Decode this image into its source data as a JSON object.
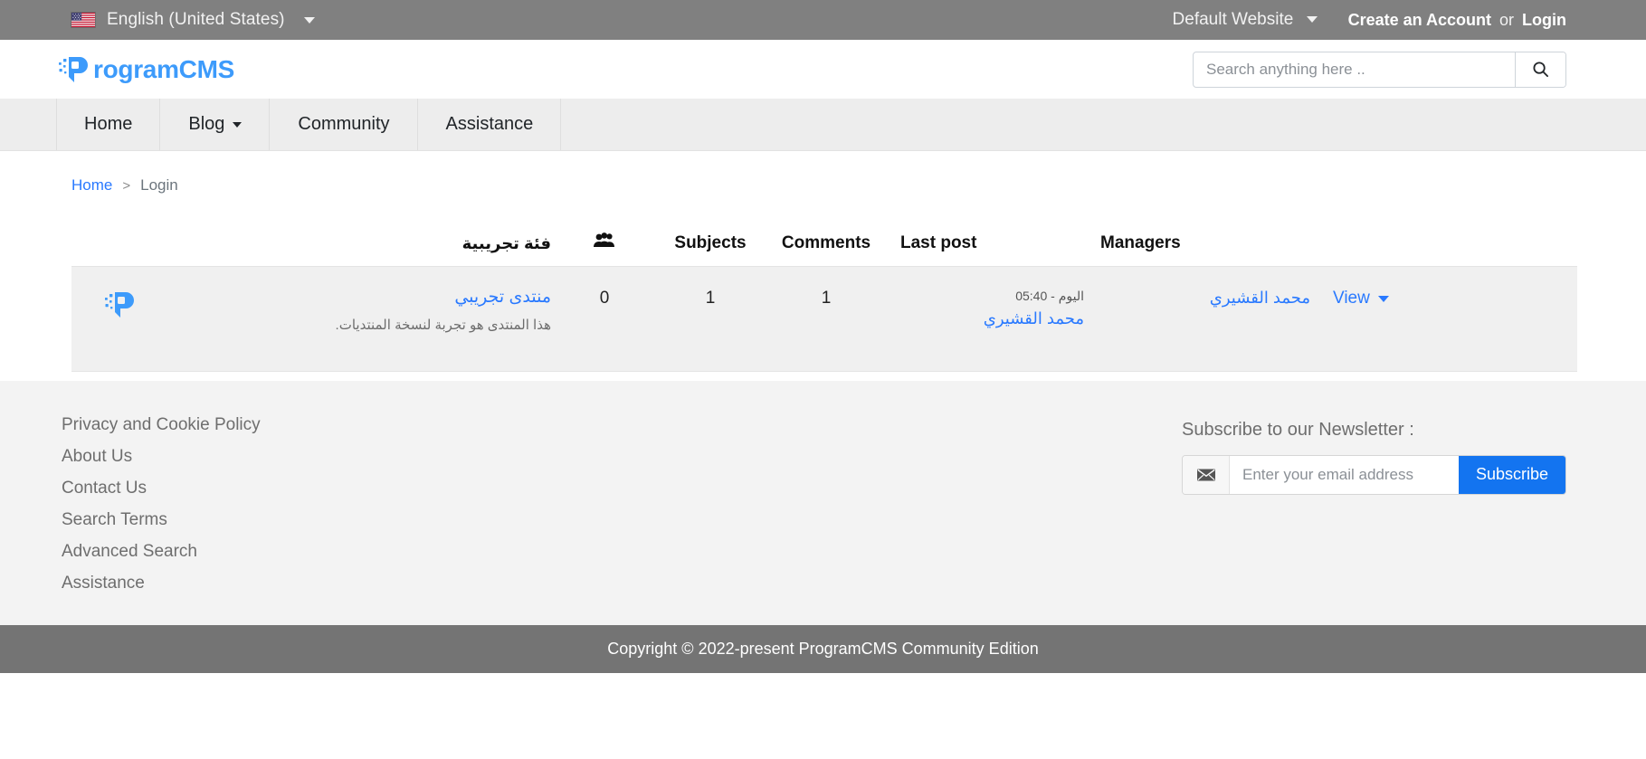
{
  "topbar": {
    "flag_icon": "us-flag-icon",
    "language": "English (United States)",
    "language_caret": "chevron-down-icon",
    "website_switcher": "Default Website",
    "create_account": "Create an Account",
    "or_text": "or",
    "login": "Login"
  },
  "header": {
    "logo_mark": "programcms-p-icon",
    "logo_text": "rogramCMS",
    "logo_color": "#3d9bfb",
    "search": {
      "placeholder": "Search anything here ..",
      "value": "",
      "button_icon": "search-icon"
    }
  },
  "nav": {
    "items": [
      {
        "label": "Home",
        "has_dropdown": false
      },
      {
        "label": "Blog",
        "has_dropdown": true
      },
      {
        "label": "Community",
        "has_dropdown": false
      },
      {
        "label": "Assistance",
        "has_dropdown": false
      }
    ]
  },
  "breadcrumb": {
    "home": "Home",
    "separator": ">",
    "current": "Login"
  },
  "forum": {
    "headers": {
      "category": "فئة تجريبية",
      "users_icon": "users-icon",
      "subjects": "Subjects",
      "comments": "Comments",
      "last_post": "Last post",
      "managers": "Managers"
    },
    "rows": [
      {
        "icon": "programcms-p-icon",
        "title": "منتدى تجريبي",
        "description": "هذا المنتدى هو تجربة لنسخة المنتديات.",
        "users": "0",
        "subjects": "1",
        "comments": "1",
        "last_post_date": "اليوم - 05:40",
        "last_post_author": "محمد القشيري",
        "managers": "محمد القشيري",
        "view_label": "View"
      }
    ]
  },
  "footer": {
    "links": [
      "Privacy and Cookie Policy",
      "About Us",
      "Contact Us",
      "Search Terms",
      "Advanced Search",
      "Assistance"
    ],
    "newsletter": {
      "title": "Subscribe to our Newsletter :",
      "envelope_icon": "envelope-icon",
      "placeholder": "Enter your email address",
      "value": "",
      "button_label": "Subscribe",
      "button_color": "#1374f0"
    }
  },
  "copyright": {
    "text": "Copyright © 2022-present ProgramCMS Community Edition"
  }
}
